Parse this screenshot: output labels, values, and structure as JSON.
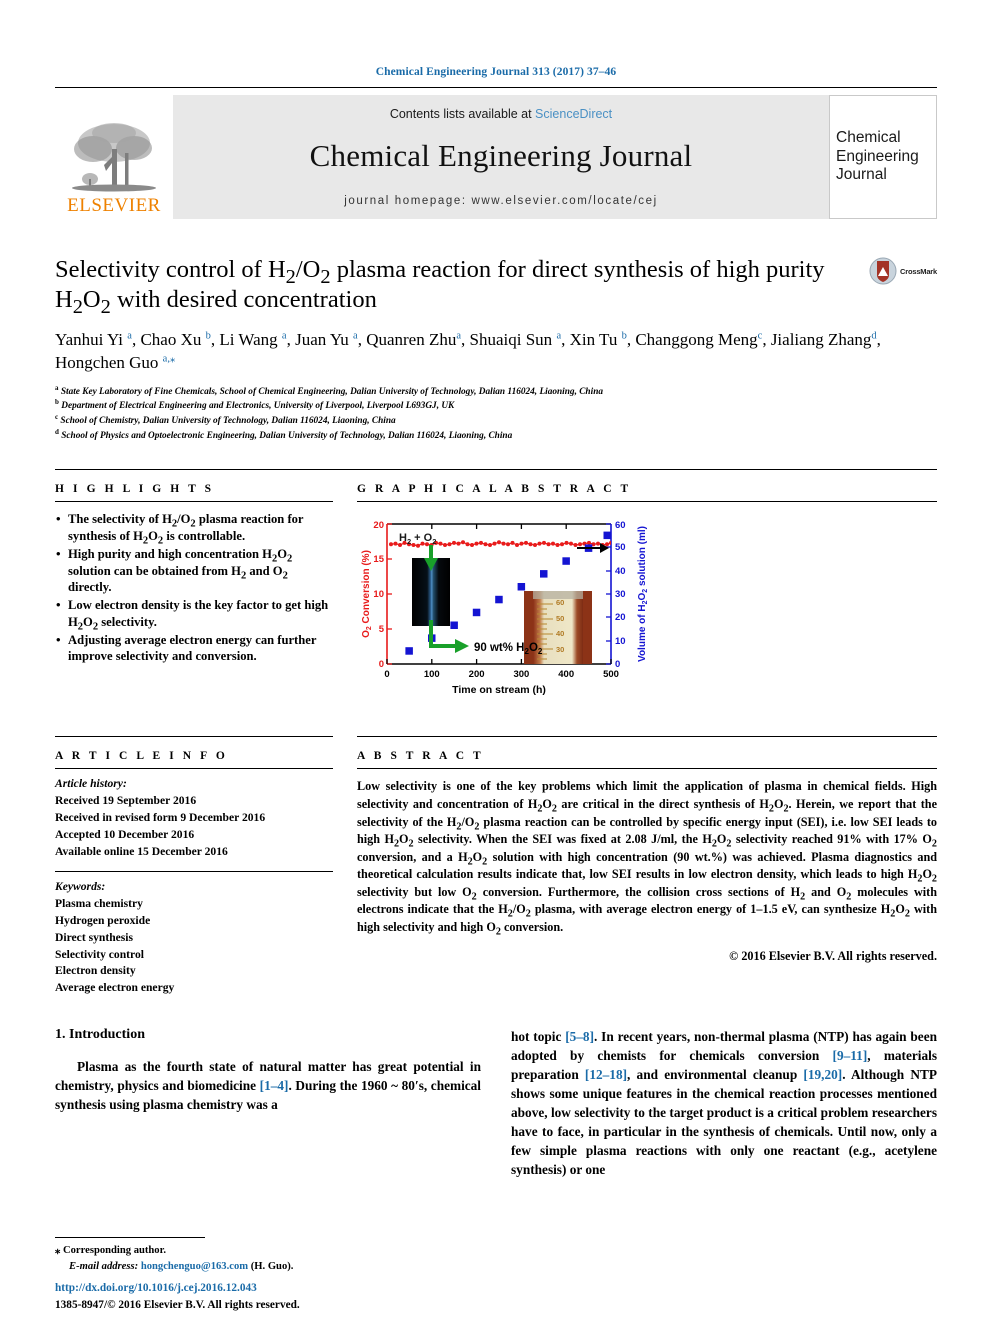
{
  "running_head": "Chemical Engineering Journal 313 (2017) 37–46",
  "masthead": {
    "publisher_name": "ELSEVIER",
    "contents_prefix": "Contents lists available at ",
    "contents_link": "ScienceDirect",
    "journal_title": "Chemical Engineering Journal",
    "homepage": "journal homepage: www.elsevier.com/locate/cej",
    "cover_line1": "Chemical",
    "cover_line2": "Engineering",
    "cover_line3": "Journal"
  },
  "article": {
    "title": "Selectivity control of H2/O2 plasma reaction for direct synthesis of high purity H2O2 with desired concentration",
    "crossmark_label": "CrossMark",
    "authors": [
      {
        "name": "Yanhui Yi",
        "marks": "a"
      },
      {
        "name": "Chao Xu",
        "marks": "b"
      },
      {
        "name": "Li Wang",
        "marks": "a"
      },
      {
        "name": "Juan Yu",
        "marks": "a"
      },
      {
        "name": "Quanren Zhu",
        "marks": "a"
      },
      {
        "name": "Shuaiqi Sun",
        "marks": "a"
      },
      {
        "name": "Xin Tu",
        "marks": "b"
      },
      {
        "name": "Changgong Meng",
        "marks": "c"
      },
      {
        "name": "Jialiang Zhang",
        "marks": "d"
      },
      {
        "name": "Hongchen Guo",
        "marks": "a,*"
      }
    ],
    "affiliations": [
      {
        "mark": "a",
        "text": "State Key Laboratory of Fine Chemicals, School of Chemical Engineering, Dalian University of Technology, Dalian 116024, Liaoning, China"
      },
      {
        "mark": "b",
        "text": "Department of Electrical Engineering and Electronics, University of Liverpool, Liverpool L693GJ, UK"
      },
      {
        "mark": "c",
        "text": "School of Chemistry, Dalian University of Technology, Dalian 116024, Liaoning, China"
      },
      {
        "mark": "d",
        "text": "School of Physics and Optoelectronic Engineering, Dalian University of Technology, Dalian 116024, Liaoning, China"
      }
    ]
  },
  "highlights": {
    "heading": "H I G H L I G H T S",
    "items": [
      "The selectivity of H2/O2 plasma reaction for synthesis of H2O2 is controllable.",
      "High purity and high concentration H2O2 solution can be obtained from H2 and O2 directly.",
      "Low electron density is the key factor to get high H2O2 selectivity.",
      "Adjusting average electron energy can further improve selectivity and conversion."
    ]
  },
  "graphical_abstract": {
    "heading": "G R A P H I C A L   A B S T R A C T"
  },
  "article_info": {
    "heading": "A R T I C L E   I N F O",
    "history_label": "Article history:",
    "history": [
      "Received 19 September 2016",
      "Received in revised form 9 December 2016",
      "Accepted 10 December 2016",
      "Available online 15 December 2016"
    ],
    "keywords_label": "Keywords:",
    "keywords": [
      "Plasma chemistry",
      "Hydrogen peroxide",
      "Direct synthesis",
      "Selectivity control",
      "Electron density",
      "Average electron energy"
    ]
  },
  "abstract": {
    "heading": "A B S T R A C T",
    "text": "Low selectivity is one of the key problems which limit the application of plasma in chemical fields. High selectivity and concentration of H2O2 are critical in the direct synthesis of H2O2. Herein, we report that the selectivity of the H2/O2 plasma reaction can be controlled by specific energy input (SEI), i.e. low SEI leads to high H2O2 selectivity. When the SEI was fixed at 2.08 J/ml, the H2O2 selectivity reached 91% with 17% O2 conversion, and a H2O2 solution with high concentration (90 wt.%) was achieved. Plasma diagnostics and theoretical calculation results indicate that, low SEI results in low electron density, which leads to high H2O2 selectivity but low O2 conversion. Furthermore, the collision cross sections of H2 and O2 molecules with electrons indicate that the H2/O2 plasma, with average electron energy of 1–1.5 eV, can synthesize H2O2 with high selectivity and high O2 conversion.",
    "copyright": "© 2016 Elsevier B.V. All rights reserved."
  },
  "body": {
    "section_number_title": "1. Introduction",
    "left_paragraph": "Plasma as the fourth state of natural matter has great potential in chemistry, physics and biomedicine [1–4]. During the 1960 ~ 80's, chemical synthesis using plasma chemistry was a",
    "right_paragraph": "hot topic [5–8]. In recent years, non-thermal plasma (NTP) has again been adopted by chemists for chemicals conversion [9–11], materials preparation [12–18], and environmental cleanup [19,20]. Although NTP shows some unique features in the chemical reaction processes mentioned above, low selectivity to the target product is a critical problem researchers have to face, in particular in the synthesis of chemicals. Until now, only a few simple plasma reactions with only one reactant (e.g., acetylene synthesis) or one"
  },
  "footer": {
    "corresponding_mark": "⁎",
    "corresponding_label": "Corresponding author.",
    "email_label": "E-mail address:",
    "email": "hongchenguo@163.com",
    "email_suffix": "(H. Guo).",
    "doi": "http://dx.doi.org/10.1016/j.cej.2016.12.043",
    "issn_copyright": "1385-8947/© 2016 Elsevier B.V. All rights reserved."
  },
  "chart_data": {
    "type": "scatter",
    "title": "",
    "xlabel": "Time on stream (h)",
    "ylabel_left": "O2 Conversion (%)",
    "ylabel_right": "Volume of H2O2 solution (ml)",
    "xlim": [
      0,
      500
    ],
    "ylim_left": [
      0,
      20
    ],
    "ylim_right": [
      0,
      60
    ],
    "xticks": [
      0,
      100,
      200,
      300,
      400,
      500
    ],
    "yticks_left": [
      0,
      5,
      10,
      15,
      20
    ],
    "yticks_right": [
      0,
      10,
      20,
      30,
      40,
      50,
      60
    ],
    "left_axis_color": "#e81b1b",
    "right_axis_color": "#1414d2",
    "grid": false,
    "annotations": [
      {
        "text": "H2 + O2",
        "color": "#1a1a1a"
      },
      {
        "text": "90 wt% H2O2",
        "color": "#000000"
      }
    ],
    "series": [
      {
        "name": "O2 Conversion (%)",
        "axis": "left",
        "color": "#e81b1b",
        "marker": "circle",
        "x": [
          10,
          20,
          30,
          40,
          50,
          60,
          70,
          80,
          90,
          100,
          110,
          120,
          130,
          140,
          150,
          160,
          170,
          180,
          190,
          200,
          210,
          220,
          230,
          240,
          250,
          260,
          270,
          280,
          290,
          300,
          310,
          320,
          330,
          340,
          350,
          360,
          370,
          380,
          390,
          400,
          410,
          420,
          430,
          440,
          450,
          460,
          470,
          480,
          490,
          500
        ],
        "y": [
          17.1,
          17.2,
          17.0,
          17.3,
          17.1,
          17.0,
          16.9,
          17.2,
          17.1,
          17.0,
          17.3,
          17.2,
          17.0,
          17.1,
          17.3,
          17.2,
          17.4,
          17.1,
          17.0,
          17.2,
          17.3,
          17.1,
          17.0,
          17.2,
          17.4,
          17.2,
          17.1,
          17.3,
          17.0,
          17.2,
          17.3,
          17.1,
          17.0,
          17.2,
          17.3,
          17.1,
          17.2,
          17.0,
          17.1,
          17.3,
          17.2,
          17.0,
          17.1,
          17.2,
          17.3,
          17.1,
          17.2,
          17.0,
          17.1,
          17.3
        ]
      },
      {
        "name": "Volume of H2O2 solution (ml)",
        "axis": "right",
        "color": "#1414d2",
        "marker": "square",
        "x": [
          50,
          100,
          150,
          200,
          250,
          300,
          350,
          400,
          450,
          500
        ],
        "y": [
          5.5,
          11,
          16.5,
          22,
          27.5,
          33,
          38.5,
          44,
          50,
          56
        ]
      }
    ]
  }
}
